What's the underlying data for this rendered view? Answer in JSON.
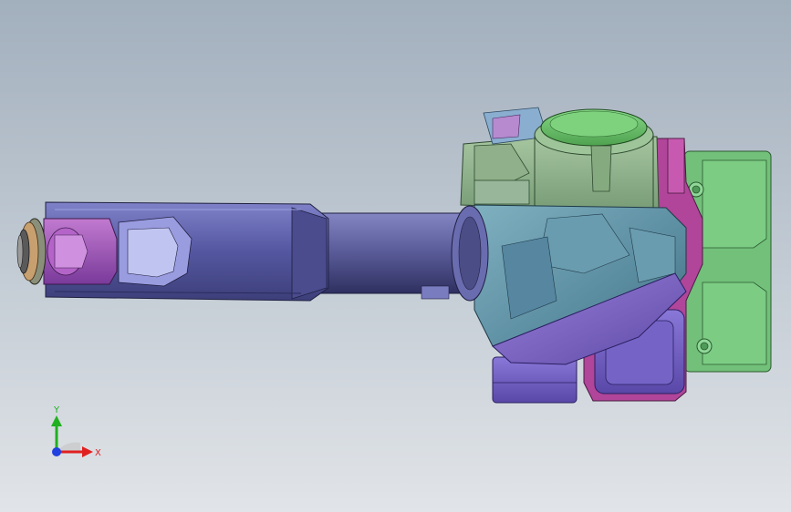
{
  "viewport": {
    "background_top": "#a2afbd",
    "background_bottom": "#e1e4e8"
  },
  "model": {
    "parts": [
      {
        "name": "forearm-link",
        "color": "#5d5fa6"
      },
      {
        "name": "wrist-fork",
        "color": "#9c4fb0"
      },
      {
        "name": "flange",
        "color": "#8a8f7a"
      },
      {
        "name": "arm-tube",
        "color": "#4b4d86"
      },
      {
        "name": "elbow-housing",
        "color": "#5f8fa3"
      },
      {
        "name": "motor-cap",
        "color": "#6fbf6f"
      },
      {
        "name": "upper-block",
        "color": "#8fb08a"
      },
      {
        "name": "side-plate",
        "color": "#72c07a"
      },
      {
        "name": "magenta-frame",
        "color": "#b0459a"
      },
      {
        "name": "gearbox",
        "color": "#6b5bbf"
      }
    ]
  },
  "triad": {
    "x_label": "X",
    "y_label": "Y",
    "x_color": "#e02020",
    "y_color": "#20b020",
    "z_color": "#2040e0"
  }
}
